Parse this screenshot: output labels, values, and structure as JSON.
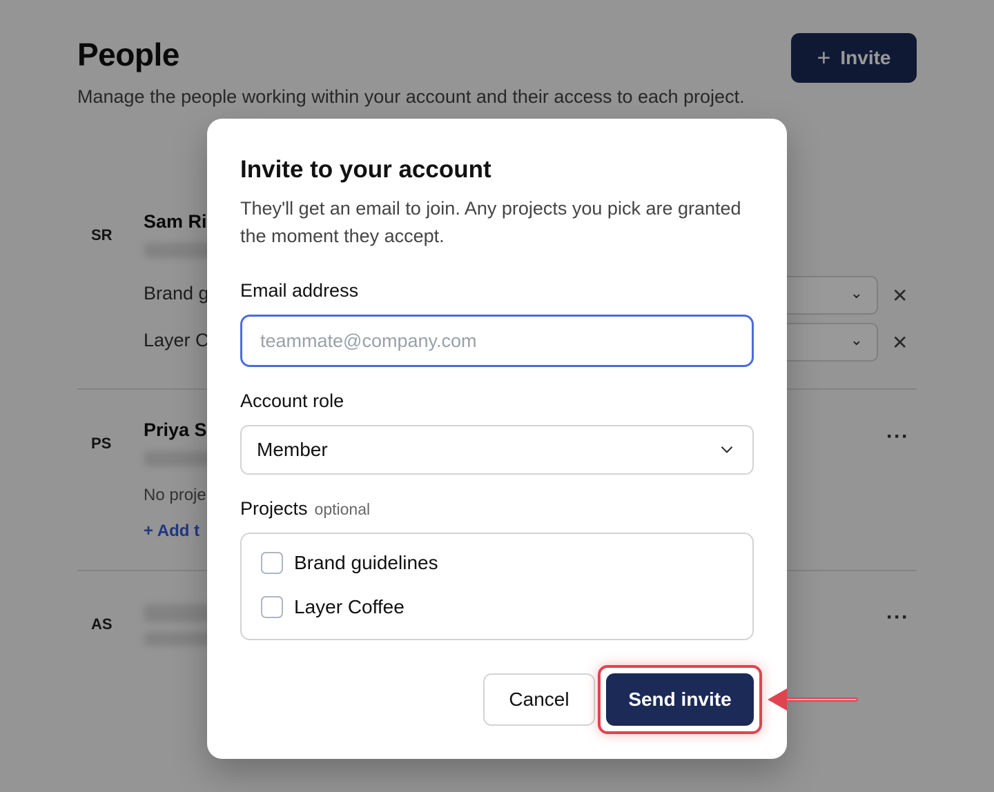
{
  "page": {
    "title": "People",
    "subtitle": "Manage the people working within your account and their access to each project.",
    "invite_button": "Invite"
  },
  "people": [
    {
      "initials": "SR",
      "name": "Sam Ri",
      "projects": [
        "Brand g",
        "Layer C"
      ]
    },
    {
      "initials": "PS",
      "name": "Priya S",
      "no_projects_text": "No proje",
      "add_link": "Add t"
    },
    {
      "initials": "AS"
    }
  ],
  "modal": {
    "title": "Invite to your account",
    "description": "They'll get an email to join. Any projects you pick are granted the moment they accept.",
    "email_label": "Email address",
    "email_placeholder": "teammate@company.com",
    "email_value": "",
    "role_label": "Account role",
    "role_value": "Member",
    "projects_label": "Projects",
    "projects_optional": "optional",
    "project_options": [
      {
        "label": "Brand guidelines",
        "checked": false
      },
      {
        "label": "Layer Coffee",
        "checked": false
      }
    ],
    "cancel_label": "Cancel",
    "send_label": "Send invite"
  },
  "colors": {
    "primary": "#1b2a57",
    "focus": "#4a6be0",
    "highlight": "#e0434f"
  }
}
